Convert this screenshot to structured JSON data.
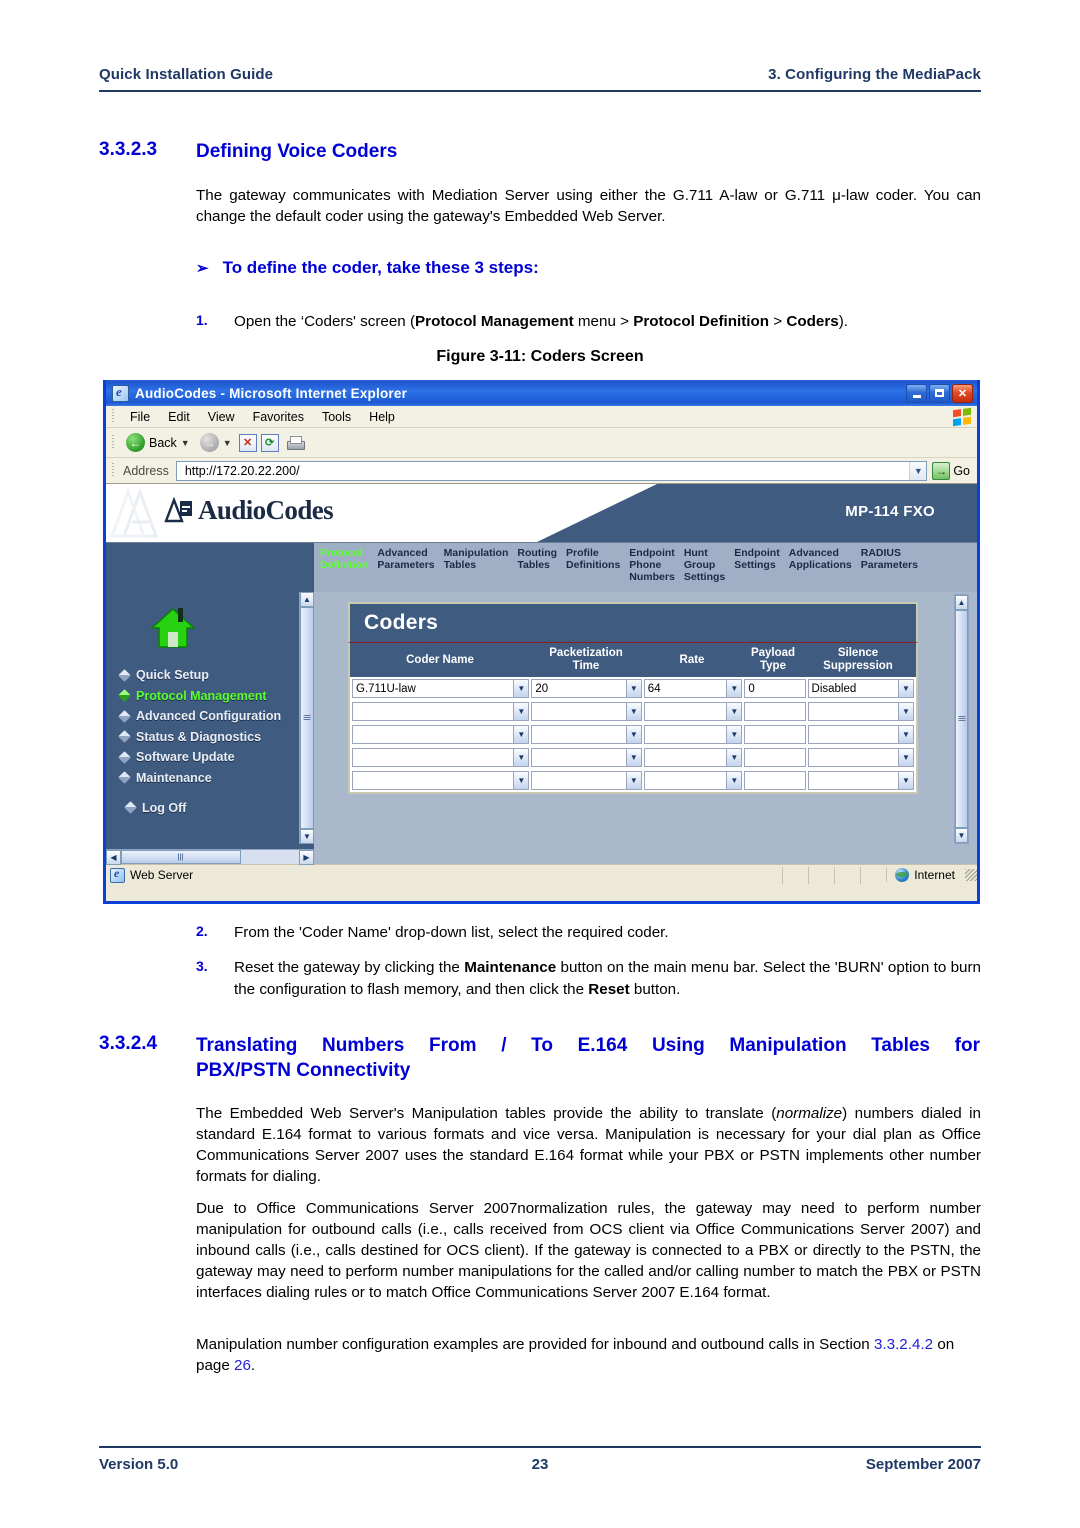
{
  "header": {
    "left": "Quick Installation Guide",
    "right": "3. Configuring the MediaPack"
  },
  "section_3323": {
    "number": "3.3.2.3",
    "title": "Defining Voice Coders",
    "paragraph": "The gateway communicates with Mediation Server using either the G.711 A-law or G.711 μ-law coder. You can change the default coder using the gateway's Embedded Web Server.",
    "procedure_arrow": "➢",
    "procedure_title": "To define the coder, take these 3 steps:",
    "step1_num": "1.",
    "step1_text": "Open the ‘Coders' screen (Protocol Management menu > Protocol Definition > Coders).",
    "step2_num": "2.",
    "step2_text": "From the 'Coder Name' drop-down list, select the required coder.",
    "step3_num": "3.",
    "step3_text": "Reset the gateway by clicking the Maintenance button on the main menu bar. Select the 'BURN' option to burn the configuration to flash memory, and then click the Reset button."
  },
  "figure": {
    "caption": "Figure 3-11: Coders Screen"
  },
  "browser": {
    "title": "AudioCodes - Microsoft Internet Explorer",
    "window_buttons": {
      "minimize": "Minimize",
      "maximize": "Maximize",
      "close": "Close"
    },
    "menu": [
      "File",
      "Edit",
      "View",
      "Favorites",
      "Tools",
      "Help"
    ],
    "toolbar": {
      "back_label": "Back",
      "forward_label": "Forward",
      "stop_label": "Stop",
      "refresh_label": "Refresh",
      "print_label": "Print"
    },
    "address_label": "Address",
    "address_value": "http://172.20.22.200/",
    "go_label": "Go",
    "status_left": "Web Server",
    "status_zone": "Internet"
  },
  "webui": {
    "brand": "AudioCodes",
    "model": "MP-114 FXO",
    "nav": [
      {
        "label": "Protocol\nDefinition",
        "active": true
      },
      {
        "label": "Advanced\nParameters",
        "active": false
      },
      {
        "label": "Manipulation\nTables",
        "active": false
      },
      {
        "label": "Routing\nTables",
        "active": false
      },
      {
        "label": "Profile\nDefinitions",
        "active": false
      },
      {
        "label": "Endpoint\nPhone\nNumbers",
        "active": false
      },
      {
        "label": "Hunt\nGroup\nSettings",
        "active": false
      },
      {
        "label": "Endpoint\nSettings",
        "active": false
      },
      {
        "label": "Advanced\nApplications",
        "active": false
      },
      {
        "label": "RADIUS\nParameters",
        "active": false
      }
    ],
    "sidebar": [
      {
        "label": "Quick Setup",
        "active": false
      },
      {
        "label": "Protocol Management",
        "active": true
      },
      {
        "label": "Advanced Configuration",
        "active": false
      },
      {
        "label": "Status & Diagnostics",
        "active": false
      },
      {
        "label": "Software Update",
        "active": false
      },
      {
        "label": "Maintenance",
        "active": false
      }
    ],
    "logoff": "Log Off",
    "panel_title": "Coders",
    "table": {
      "columns": [
        "Coder Name",
        "Packetization\nTime",
        "Rate",
        "Payload\nType",
        "Silence\nSuppression"
      ],
      "rows": [
        {
          "coder_name": "G.711U-law",
          "packetization_time": "20",
          "rate": "64",
          "payload_type": "0",
          "silence_suppression": "Disabled"
        },
        {
          "coder_name": "",
          "packetization_time": "",
          "rate": "",
          "payload_type": "",
          "silence_suppression": ""
        },
        {
          "coder_name": "",
          "packetization_time": "",
          "rate": "",
          "payload_type": "",
          "silence_suppression": ""
        },
        {
          "coder_name": "",
          "packetization_time": "",
          "rate": "",
          "payload_type": "",
          "silence_suppression": ""
        },
        {
          "coder_name": "",
          "packetization_time": "",
          "rate": "",
          "payload_type": "",
          "silence_suppression": ""
        }
      ]
    }
  },
  "section_3324": {
    "number": "3.3.2.4",
    "title_line1": "Translating Numbers From / To E.164 Using Manipulation Tables for",
    "title_line2": "PBX/PSTN Connectivity",
    "paragraph1": "The Embedded Web Server's Manipulation tables provide the ability to translate (normalize) numbers dialed in standard E.164 format to various formats and vice versa. Manipulation is necessary for your dial plan as Office Communications Server 2007 uses the standard E.164 format while your PBX or PSTN implements other number formats for dialing.",
    "paragraph2": "Due to Office Communications Server 2007normalization rules, the gateway may need to perform number manipulation for outbound calls (i.e., calls received from OCS client via Office Communications Server 2007) and inbound calls (i.e., calls destined for OCS client). If the gateway is connected to a PBX or directly to the PSTN, the gateway may need to perform number manipulations for the called and/or calling number to match the PBX or PSTN interfaces dialing rules or to match Office Communications Server 2007 E.164 format.",
    "paragraph3": "Manipulation number configuration examples are provided for inbound and outbound calls in Section 3.3.2.4.2 on page 26.",
    "ref_section": "3.3.2.4.2",
    "ref_page": "26"
  },
  "footer": {
    "version": "Version 5.0",
    "page": "23",
    "date": "September 2007"
  }
}
